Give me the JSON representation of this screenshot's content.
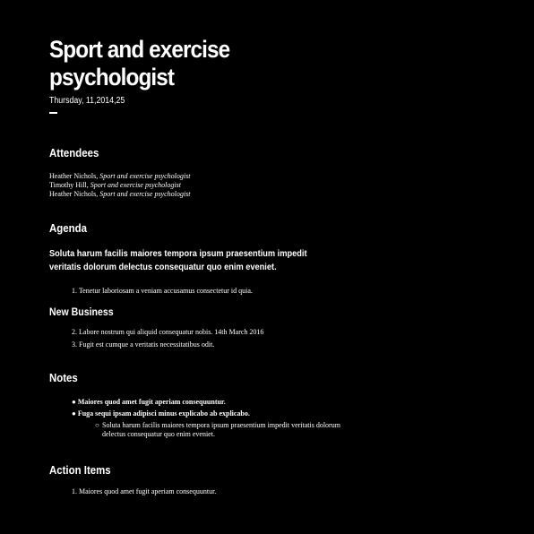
{
  "title": "Sport and exercise psychologist",
  "date": "Thursday, 11,2014,25",
  "attendees": {
    "heading": "Attendees",
    "people": [
      {
        "name": "Heather Nichols",
        "role": "Sport and exercise psychologist"
      },
      {
        "name": "Timothy Hill",
        "role": "Sport and exercise psychologist"
      },
      {
        "name": "Heather Nichols",
        "role": "Sport and exercise psychologist"
      }
    ]
  },
  "agenda": {
    "heading": "Agenda",
    "lead": "Soluta harum facilis maiores tempora ipsum praesentium impedit veritatis dolorum delectus consequatur quo enim eveniet.",
    "items": [
      "1. Tenetur laboriosam a veniam accusamus consectetur id quia."
    ]
  },
  "new_business": {
    "heading": "New Business",
    "items": [
      "2. Labore nostrum qui aliquid consequatur nobis. 14th March 2016",
      "3. Fugit est cumque a veritatis necessitatibus odit."
    ]
  },
  "notes": {
    "heading": "Notes",
    "items": [
      "Maiores quod amet fugit aperiam consequuntur.",
      "Fuga sequi ipsam adipisci minus explicabo ab explicabo."
    ],
    "sub_item": "Soluta harum facilis maiores tempora ipsum praesentium impedit veritatis dolorum delectus consequatur quo enim eveniet."
  },
  "action_items": {
    "heading": "Action Items",
    "items": [
      "1. Maiores quod amet fugit aperiam consequuntur."
    ]
  }
}
